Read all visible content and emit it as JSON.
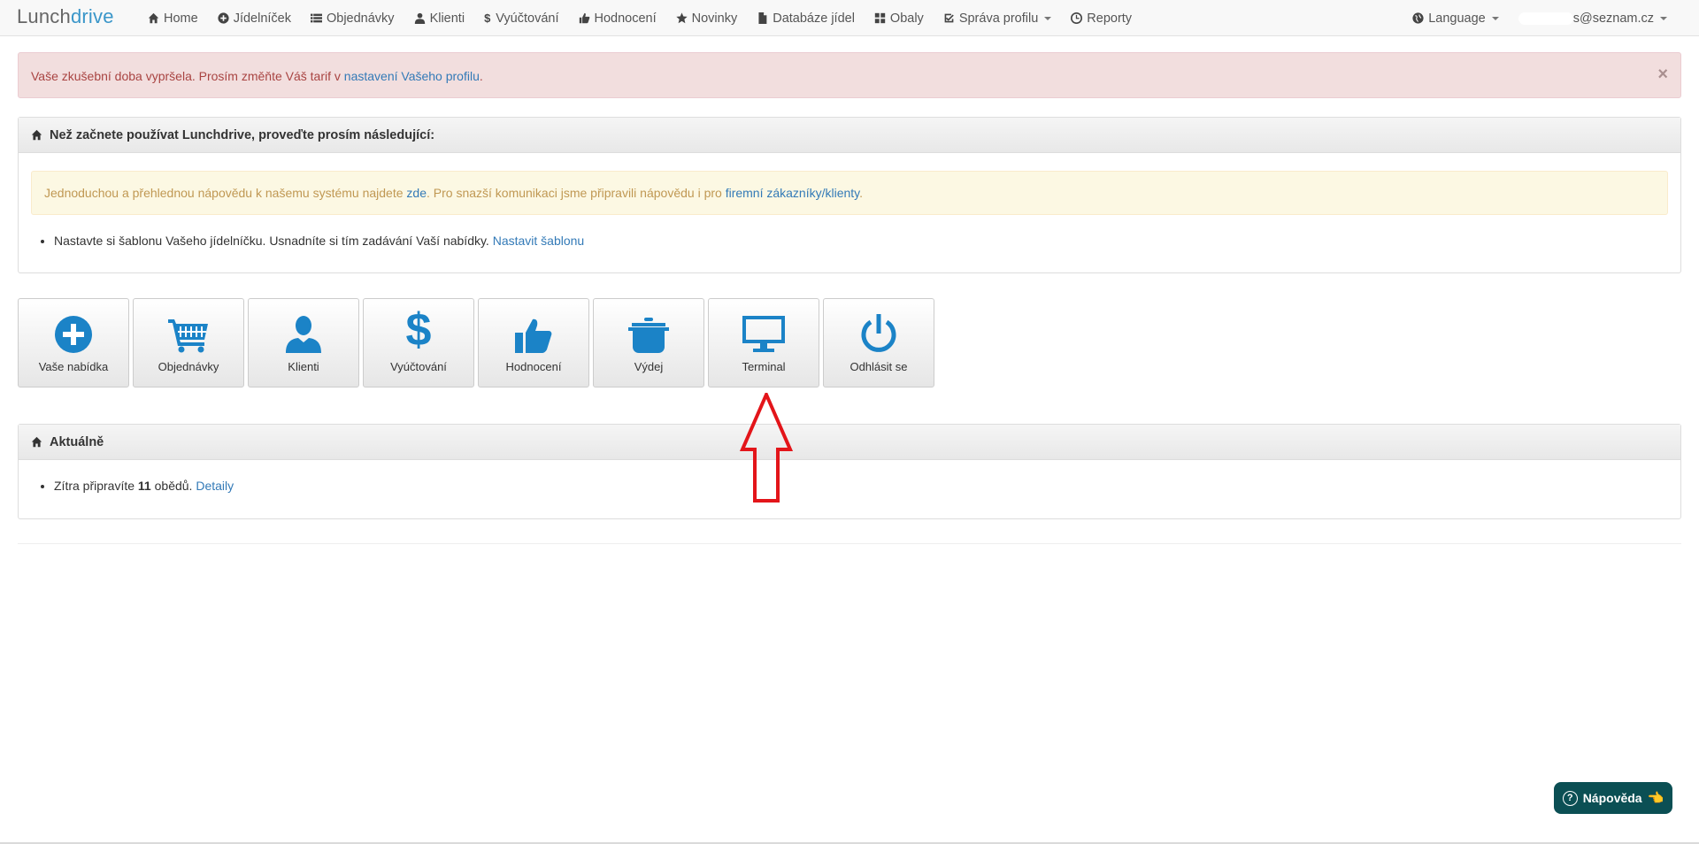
{
  "brand": {
    "part1": "Lunch",
    "part2": "drive"
  },
  "nav": {
    "items": [
      {
        "label": "Home",
        "icon": "home-icon"
      },
      {
        "label": "Jídelníček",
        "icon": "plus-circle-icon"
      },
      {
        "label": "Objednávky",
        "icon": "list-icon"
      },
      {
        "label": "Klienti",
        "icon": "user-icon"
      },
      {
        "label": "Vyúčtování",
        "icon": "dollar-icon",
        "glyph": "$"
      },
      {
        "label": "Hodnocení",
        "icon": "thumbs-up-icon"
      },
      {
        "label": "Novinky",
        "icon": "star-icon"
      },
      {
        "label": "Databáze jídel",
        "icon": "file-icon"
      },
      {
        "label": "Obaly",
        "icon": "grid-icon"
      },
      {
        "label": "Správa profilu",
        "icon": "check-square-icon"
      },
      {
        "label": "Reporty",
        "icon": "clock-icon"
      }
    ],
    "language": "Language",
    "email": "s@seznam.cz"
  },
  "alert": {
    "text": "Vaše zkušební doba vypršela. Prosím změňte Váš tarif v ",
    "link": "nastavení Vašeho profilu",
    "end": ".",
    "close": "×"
  },
  "setup_panel": {
    "title": "Než začnete používat Lunchdrive, proveďte prosím následující:",
    "help_text_1": "Jednoduchou a přehlednou nápovědu k našemu systému najdete ",
    "help_link_1": "zde",
    "help_text_2": ". Pro snazší komunikaci jsme připravili nápovědu i pro ",
    "help_link_2": "firemní zákazníky/klienty",
    "help_text_3": ".",
    "item_text": "Nastavte si šablonu Vašeho jídelníčku. Usnadníte si tím zadávání Vaší nabídky. ",
    "item_link": "Nastavit šablonu"
  },
  "tiles": [
    {
      "label": "Vaše nabídka",
      "icon": "plus-circle-icon"
    },
    {
      "label": "Objednávky",
      "icon": "cart-icon"
    },
    {
      "label": "Klienti",
      "icon": "user-icon"
    },
    {
      "label": "Vyúčtování",
      "icon": "dollar-icon",
      "glyph": "$"
    },
    {
      "label": "Hodnocení",
      "icon": "thumbs-up-icon"
    },
    {
      "label": "Výdej",
      "icon": "pot-icon"
    },
    {
      "label": "Terminal",
      "icon": "monitor-icon"
    },
    {
      "label": "Odhlásit se",
      "icon": "power-icon"
    }
  ],
  "news_panel": {
    "title": "Aktuálně",
    "text_1": "Zítra připravíte ",
    "count": "11",
    "text_2": " obědů. ",
    "link": "Detaily"
  },
  "help_widget": {
    "label": "Nápověda",
    "q": "?",
    "hand": "👈"
  },
  "colors": {
    "accent": "#1b83c7",
    "link": "#337ab7",
    "danger_bg": "#f2dede",
    "warning_bg": "#fcf8e3",
    "arrow": "#e3151a",
    "help_bg": "#0b4f54"
  }
}
